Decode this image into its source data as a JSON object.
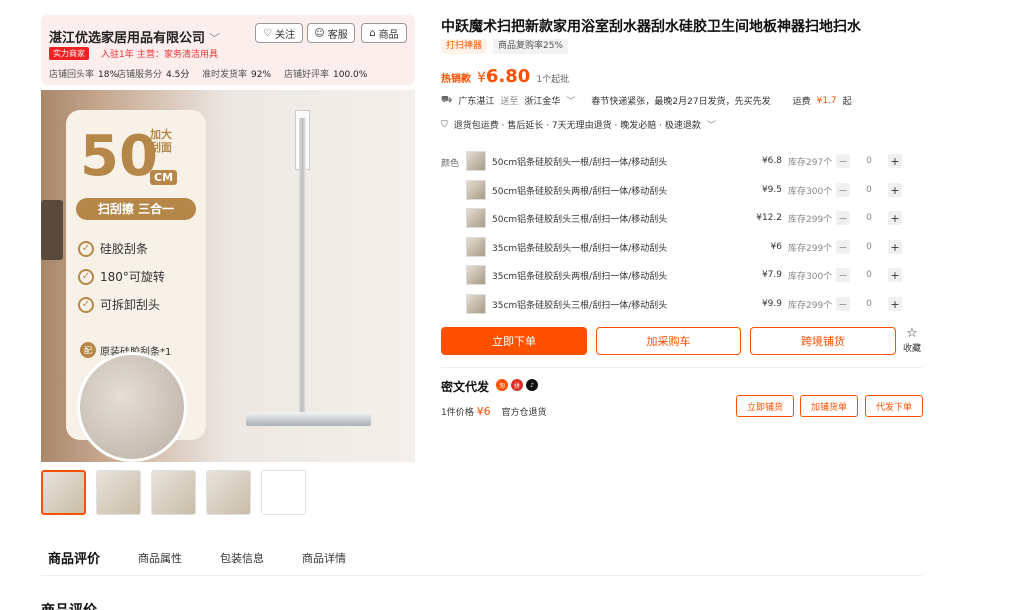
{
  "shop": {
    "name": "湛江优选家居用品有限公司",
    "follow": "关注",
    "service": "客服",
    "goods": "商品",
    "badge": "实力商家",
    "joined": "入驻1年",
    "main_cat": "主营：家务清洁用具",
    "stats": [
      {
        "label": "店铺回头率",
        "value": "18%"
      },
      {
        "label": "店铺服务分",
        "value": "4.5分"
      },
      {
        "label": "准时发货率",
        "value": "92%"
      },
      {
        "label": "店铺好评率",
        "value": "100.0%"
      }
    ]
  },
  "image": {
    "size_num": "50",
    "size_top": "加大",
    "size_mid": "刮面",
    "size_unit": "CM",
    "pill": "扫刮擦 三合一",
    "features": [
      "硅胶刮条",
      "180°可旋转",
      "可拆卸刮头"
    ],
    "gift_icon": "配",
    "gift": "原装硅胶刮条*1"
  },
  "product": {
    "title": "中跃魔术扫把新款家用浴室刮水器刮水硅胶卫生间地板神器扫地扫水",
    "tag1": "打扫神器",
    "tag2": "商品复购率25%",
    "price_label": "热销款",
    "currency": "¥",
    "price": "6.80",
    "moq": "1个起批",
    "ship_from": "广东湛江",
    "ship_word": "送至",
    "ship_to": "浙江金华",
    "ship_note": "春节快递紧张，最晚2月27日发货，先买先发",
    "freight_label": "运费",
    "freight": "¥1.7",
    "freight_suffix": "起",
    "guarantees": "退货包运费 · 售后延长 · 7天无理由退货 · 晚发必赔 · 极速退款"
  },
  "sku": {
    "label": "颜色",
    "rows": [
      {
        "name": "50cm铝条硅胶刮头一根/刮扫一体/移动刮头",
        "price": "¥6.8",
        "stock": "库存297个",
        "qty": "0"
      },
      {
        "name": "50cm铝条硅胶刮头两根/刮扫一体/移动刮头",
        "price": "¥9.5",
        "stock": "库存300个",
        "qty": "0"
      },
      {
        "name": "50cm铝条硅胶刮头三根/刮扫一体/移动刮头",
        "price": "¥12.2",
        "stock": "库存299个",
        "qty": "0"
      },
      {
        "name": "35cm铝条硅胶刮头一根/刮扫一体/移动刮头",
        "price": "¥6",
        "stock": "库存299个",
        "qty": "0"
      },
      {
        "name": "35cm铝条硅胶刮头两根/刮扫一体/移动刮头",
        "price": "¥7.9",
        "stock": "库存300个",
        "qty": "0"
      },
      {
        "name": "35cm铝条硅胶刮头三根/刮扫一体/移动刮头",
        "price": "¥9.9",
        "stock": "库存299个",
        "qty": "0"
      }
    ]
  },
  "actions": {
    "buy": "立即下单",
    "cart": "加采购车",
    "cross": "跨境铺货",
    "fav": "收藏"
  },
  "miwen": {
    "title": "密文代发",
    "unit_price_label": "1件价格",
    "unit_price": "¥6",
    "return_note": "官方仓退货",
    "btn1": "立即铺货",
    "btn2": "加铺货单",
    "btn3": "代发下单"
  },
  "tabs": [
    "商品评价",
    "商品属性",
    "包装信息",
    "商品详情"
  ],
  "reviews_heading": "商品评价",
  "colors": {
    "accent": "#ff5000",
    "gold": "#b5884a"
  }
}
